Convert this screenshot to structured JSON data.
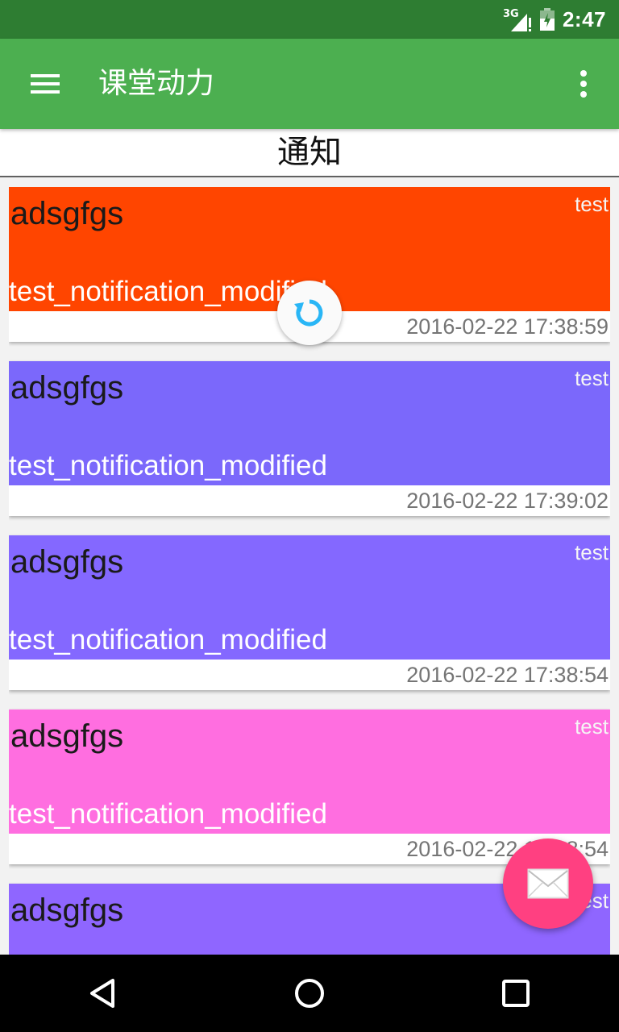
{
  "status_bar": {
    "network": "3G",
    "time": "2:47",
    "icons": [
      "signal-icon",
      "battery-icon"
    ]
  },
  "app_bar": {
    "title": "课堂动力",
    "icons": [
      "menu-icon",
      "more-vert-icon"
    ]
  },
  "section": {
    "title": "通知"
  },
  "notifications": [
    {
      "title": "adsgfgs",
      "author": "test",
      "content": "test_notification_modified",
      "time": "2016-02-22 17:38:59",
      "color": "#ff4500"
    },
    {
      "title": "adsgfgs",
      "author": "test",
      "content": "test_notification_modified",
      "time": "2016-02-22 17:39:02",
      "color": "#7b68fb"
    },
    {
      "title": "adsgfgs",
      "author": "test",
      "content": "test_notification_modified",
      "time": "2016-02-22 17:38:54",
      "color": "#8468ff"
    },
    {
      "title": "adsgfgs",
      "author": "test",
      "content": "test_notification_modified",
      "time": "2016-02-22 17:38:54",
      "color": "#ff6ee0"
    },
    {
      "title": "adsgfgs",
      "author": "test",
      "content": "",
      "time": "",
      "color": "#8f66ff"
    }
  ],
  "refresh": {
    "icon": "refresh-icon",
    "color": "#29b6f6"
  },
  "fab": {
    "icon": "mail-icon",
    "color": "#ff4081"
  },
  "nav_bar": {
    "icons": [
      "back-icon",
      "home-icon",
      "recents-icon"
    ]
  },
  "colors": {
    "status_bar": "#2e7d32",
    "app_bar": "#4caf50"
  }
}
